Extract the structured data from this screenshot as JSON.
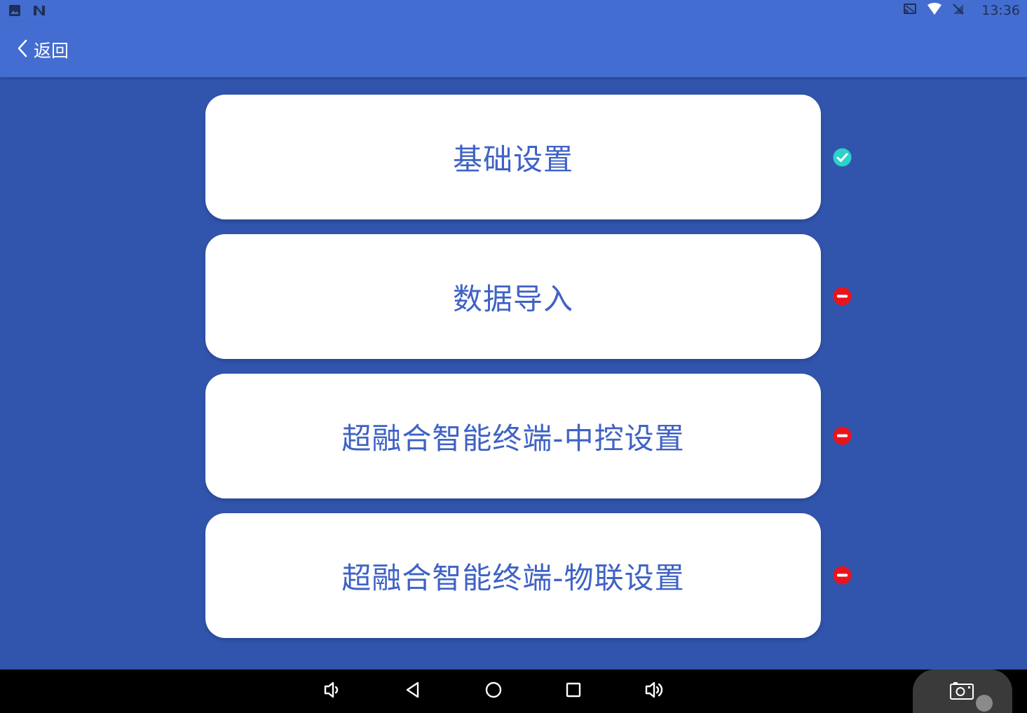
{
  "status_bar": {
    "time": "13:36",
    "left_icons": [
      "image-icon",
      "n-notification-icon"
    ],
    "right_icons": [
      "cast-icon",
      "wifi-icon",
      "no-signal-icon"
    ]
  },
  "header": {
    "back_label": "返回"
  },
  "menu": {
    "items": [
      {
        "label": "基础设置",
        "status": "done"
      },
      {
        "label": "数据导入",
        "status": "blocked"
      },
      {
        "label": "超融合智能终端-中控设置",
        "status": "blocked"
      },
      {
        "label": "超融合智能终端-物联设置",
        "status": "blocked"
      }
    ]
  },
  "colors": {
    "background": "#3155ad",
    "header": "#436dd0",
    "card_text": "#3f62c5",
    "status_done": "#2ed1c7",
    "status_blocked": "#e8141c"
  },
  "navbar": {
    "buttons": [
      "volume-down-icon",
      "back-triangle-icon",
      "home-circle-icon",
      "recents-square-icon",
      "volume-up-icon",
      "screenshot-camera-icon"
    ]
  }
}
